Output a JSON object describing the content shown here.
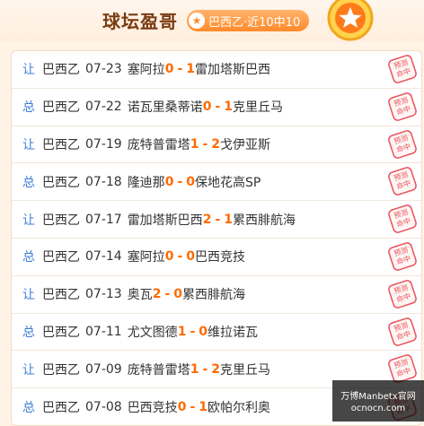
{
  "header": {
    "title": "球坛盈哥",
    "badge_label": "巴西乙·近10中10"
  },
  "rows": [
    {
      "type": "让",
      "league": "巴西乙",
      "date": "07-23",
      "home": "塞阿拉",
      "home_score": "0",
      "away_score": "1",
      "away": "雷加塔斯巴西",
      "stamp": "预测命中"
    },
    {
      "type": "总",
      "league": "巴西乙",
      "date": "07-22",
      "home": "诺瓦里桑蒂诺",
      "home_score": "0",
      "away_score": "1",
      "away": "克里丘马",
      "stamp": "预测命中"
    },
    {
      "type": "让",
      "league": "巴西乙",
      "date": "07-19",
      "home": "庞特普雷塔",
      "home_score": "1",
      "away_score": "2",
      "away": "戈伊亚斯",
      "stamp": "预测命中"
    },
    {
      "type": "总",
      "league": "巴西乙",
      "date": "07-18",
      "home": "隆迪那",
      "home_score": "0",
      "away_score": "0",
      "away": "保地花高SP",
      "stamp": "预测命中"
    },
    {
      "type": "让",
      "league": "巴西乙",
      "date": "07-17",
      "home": "雷加塔斯巴西",
      "home_score": "2",
      "away_score": "1",
      "away": "累西腓航海",
      "stamp": "预测命中"
    },
    {
      "type": "总",
      "league": "巴西乙",
      "date": "07-14",
      "home": "塞阿拉",
      "home_score": "0",
      "away_score": "0",
      "away": "巴西竞技",
      "stamp": "预测命中"
    },
    {
      "type": "让",
      "league": "巴西乙",
      "date": "07-13",
      "home": "奥瓦",
      "home_score": "2",
      "away_score": "0",
      "away": "累西腓航海",
      "stamp": "预测命中"
    },
    {
      "type": "总",
      "league": "巴西乙",
      "date": "07-11",
      "home": "尤文图德",
      "home_score": "1",
      "away_score": "0",
      "away": "维拉诺瓦",
      "stamp": "预测命中"
    },
    {
      "type": "让",
      "league": "巴西乙",
      "date": "07-09",
      "home": "庞特普雷塔",
      "home_score": "1",
      "away_score": "2",
      "away": "克里丘马",
      "stamp": "预测命中"
    },
    {
      "type": "总",
      "league": "巴西乙",
      "date": "07-08",
      "home": "巴西竞技",
      "home_score": "0",
      "away_score": "1",
      "away": "欧帕尔利奥",
      "stamp": "预测命中"
    }
  ],
  "watermark": {
    "line1": "万博Manbetx官网",
    "line2": "ocnocn.com"
  },
  "colors": {
    "accent": "#ff6a00",
    "type_blue": "#3d7dd8",
    "stamp_red": "#e8545a"
  }
}
